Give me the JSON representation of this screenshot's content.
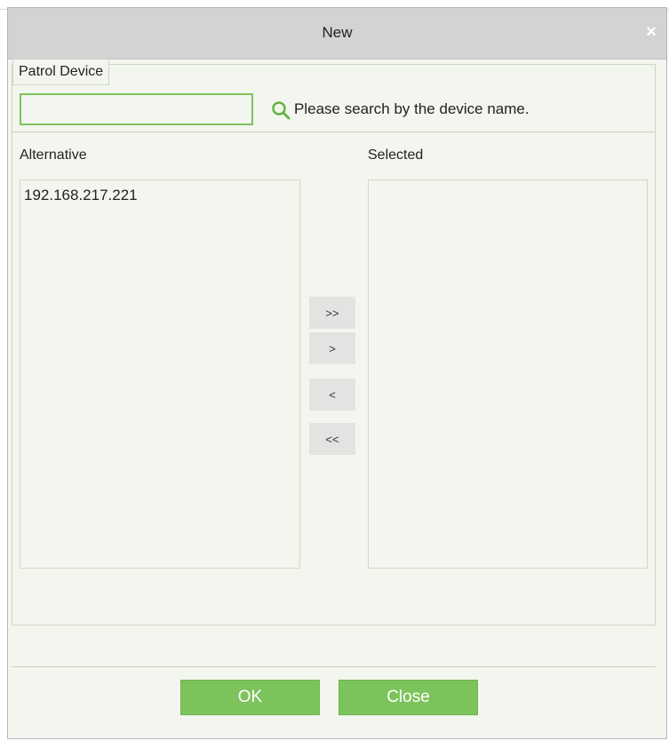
{
  "dialog": {
    "title": "New",
    "close_glyph": "×"
  },
  "patrol_device": {
    "legend": "Patrol Device",
    "search_value": "",
    "search_hint": "Please search by the device name."
  },
  "transfer": {
    "alternative_label": "Alternative",
    "selected_label": "Selected",
    "alternative_items": [
      "192.168.217.221"
    ],
    "selected_items": [],
    "buttons": {
      "move_all_right": ">>",
      "move_right": ">",
      "move_left": "<",
      "move_all_left": "<<"
    }
  },
  "footer": {
    "ok_label": "OK",
    "close_label": "Close"
  },
  "colors": {
    "accent_green": "#7dc35b",
    "titlebar_gray": "#d3d3d3",
    "panel_bg": "#f3f5ef"
  },
  "icons": {
    "search": "search-icon",
    "close": "close-icon"
  }
}
